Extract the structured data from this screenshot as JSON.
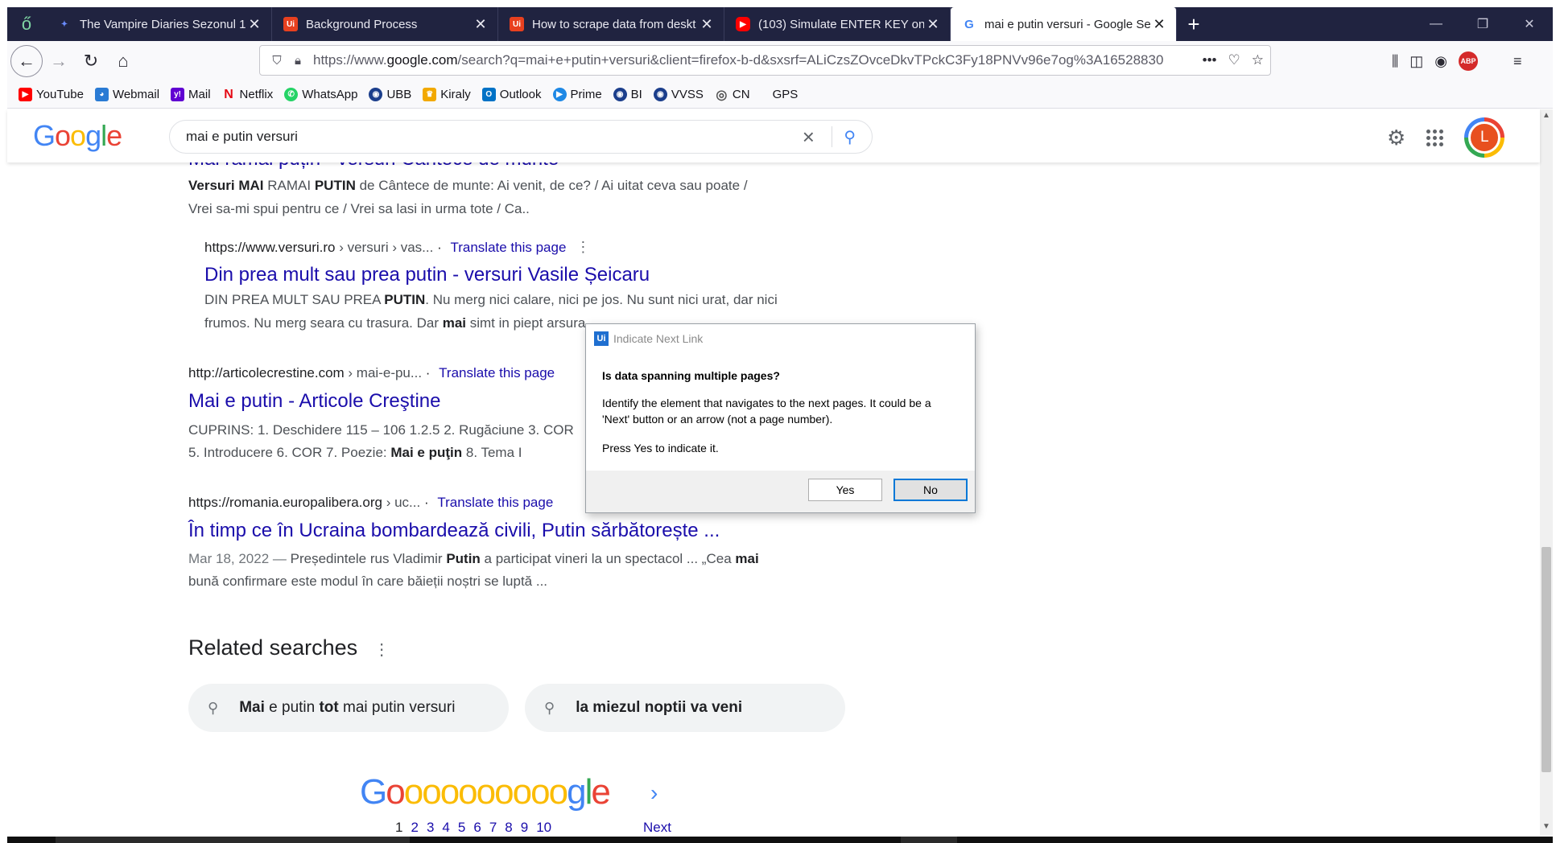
{
  "browser": {
    "tabs": [
      {
        "title": "The Vampire Diaries Sezonul 1",
        "fav_color": "#3a5bd9",
        "fav_glyph": "✦"
      },
      {
        "title": "Background Process",
        "fav_color": "#e8401f",
        "fav_glyph": "Ui"
      },
      {
        "title": "How to scrape data from deskt",
        "fav_color": "#e8401f",
        "fav_glyph": "Ui"
      },
      {
        "title": "(103) Simulate ENTER KEY on t",
        "fav_color": "#ff0000",
        "fav_glyph": "▶"
      },
      {
        "title": "mai e putin versuri - Google Se",
        "fav_color": "#ffffff",
        "fav_glyph": "G"
      }
    ],
    "url_prefix": "https://www.",
    "url_domain": "google.com",
    "url_rest": "/search?q=mai+e+putin+versuri&client=firefox-b-d&sxsrf=ALiCzsZOvceDkvTPckC3Fy18PNVv96e7og%3A16528830",
    "url_more": "•••",
    "bookmarks": [
      {
        "label": "YouTube",
        "color": "#ff0000",
        "glyph": "▶"
      },
      {
        "label": "Webmail",
        "color": "#2a7bd4",
        "glyph": "◕"
      },
      {
        "label": "Mail",
        "color": "#6001d2",
        "glyph": "y!"
      },
      {
        "label": "Netflix",
        "color": "#e50914",
        "glyph": "N"
      },
      {
        "label": "WhatsApp",
        "color": "#25d366",
        "glyph": "✆"
      },
      {
        "label": "UBB",
        "color": "#1c3f8c",
        "glyph": "◉"
      },
      {
        "label": "Kiraly",
        "color": "#f2a900",
        "glyph": "♛"
      },
      {
        "label": "Outlook",
        "color": "#0072c6",
        "glyph": "O"
      },
      {
        "label": "Prime",
        "color": "#1e88e5",
        "glyph": "▶"
      },
      {
        "label": "BI",
        "color": "#1c3f8c",
        "glyph": "◉"
      },
      {
        "label": "VVSS",
        "color": "#1c3f8c",
        "glyph": "◉"
      },
      {
        "label": "CN",
        "color": "#555555",
        "glyph": "◎"
      },
      {
        "label": "GPS",
        "color": "#ffffff",
        "glyph": ""
      }
    ]
  },
  "google": {
    "query": "mai e putin versuri",
    "avatar_letter": "L"
  },
  "results": {
    "r0_title_partial": "Mai rămâi puțin - versuri Cântece de munte",
    "r0_s1_b1": "Versuri MAI",
    "r0_s1_t1": " RAMAI ",
    "r0_s1_b2": "PUTIN",
    "r0_s1_t2": " de Cântece de munte: Ai venit, de ce? / Ai uitat ceva sau poate /",
    "r0_s2": "Vrei sa-mi spui pentru ce / Vrei sa lasi in urma tote / Ca..",
    "r1_site": "https://www.versuri.ro",
    "r1_path": " › versuri › vas...",
    "r1_title": "Din prea mult sau prea putin - versuri Vasile Șeicaru",
    "r1_s1_t1": "DIN PREA MULT SAU PREA ",
    "r1_s1_b1": "PUTIN",
    "r1_s1_t2": ". Nu merg nici calare, nici pe jos. Nu sunt nici urat, dar nici",
    "r1_s2_t1": "frumos. Nu merg seara cu trasura. Dar ",
    "r1_s2_b1": "mai",
    "r1_s2_t2": " simt in piept arsura.",
    "r2_site": "http://articolecrestine.com",
    "r2_path": " › mai-e-pu...",
    "r2_title": "Mai e putin - Articole Creştine",
    "r2_s1": "CUPRINS: 1. Deschidere 115 – 106 1.2.5 2. Rugăciune 3. COR",
    "r2_s2_t1": "5. Introducere 6. COR 7. Poezie: ",
    "r2_s2_b1": "Mai e puţin",
    "r2_s2_t2": " 8. Tema I",
    "r3_site": "https://romania.europalibera.org",
    "r3_path": " › uc...",
    "r3_title": "În timp ce în Ucraina bombardează civili, Putin sărbătorește ...",
    "r3_date": "Mar 18, 2022 — ",
    "r3_s1_t1": "Președintele rus Vladimir ",
    "r3_s1_b1": "Putin",
    "r3_s1_t2": " a participat vineri la un spectacol ... „Cea ",
    "r3_s1_b2": "mai",
    "r3_s2": "bună confirmare este modul în care băieții noștri se luptă ...",
    "translate": "Translate this page"
  },
  "related": {
    "heading": "Related searches",
    "c1_b1": "Mai",
    "c1_t1": " e putin ",
    "c1_b2": "tot",
    "c1_t2": " mai putin versuri",
    "c2": "la miezul noptii va veni"
  },
  "pager": {
    "pages": [
      "1",
      "2",
      "3",
      "4",
      "5",
      "6",
      "7",
      "8",
      "9",
      "10"
    ],
    "next": "Next"
  },
  "dialog": {
    "title": "Indicate Next Link",
    "question": "Is data spanning multiple pages?",
    "description": "Identify the element that navigates to the next pages. It could be a 'Next' button or an arrow (not a page number).",
    "press": "Press Yes to indicate it.",
    "yes": "Yes",
    "no": "No"
  }
}
